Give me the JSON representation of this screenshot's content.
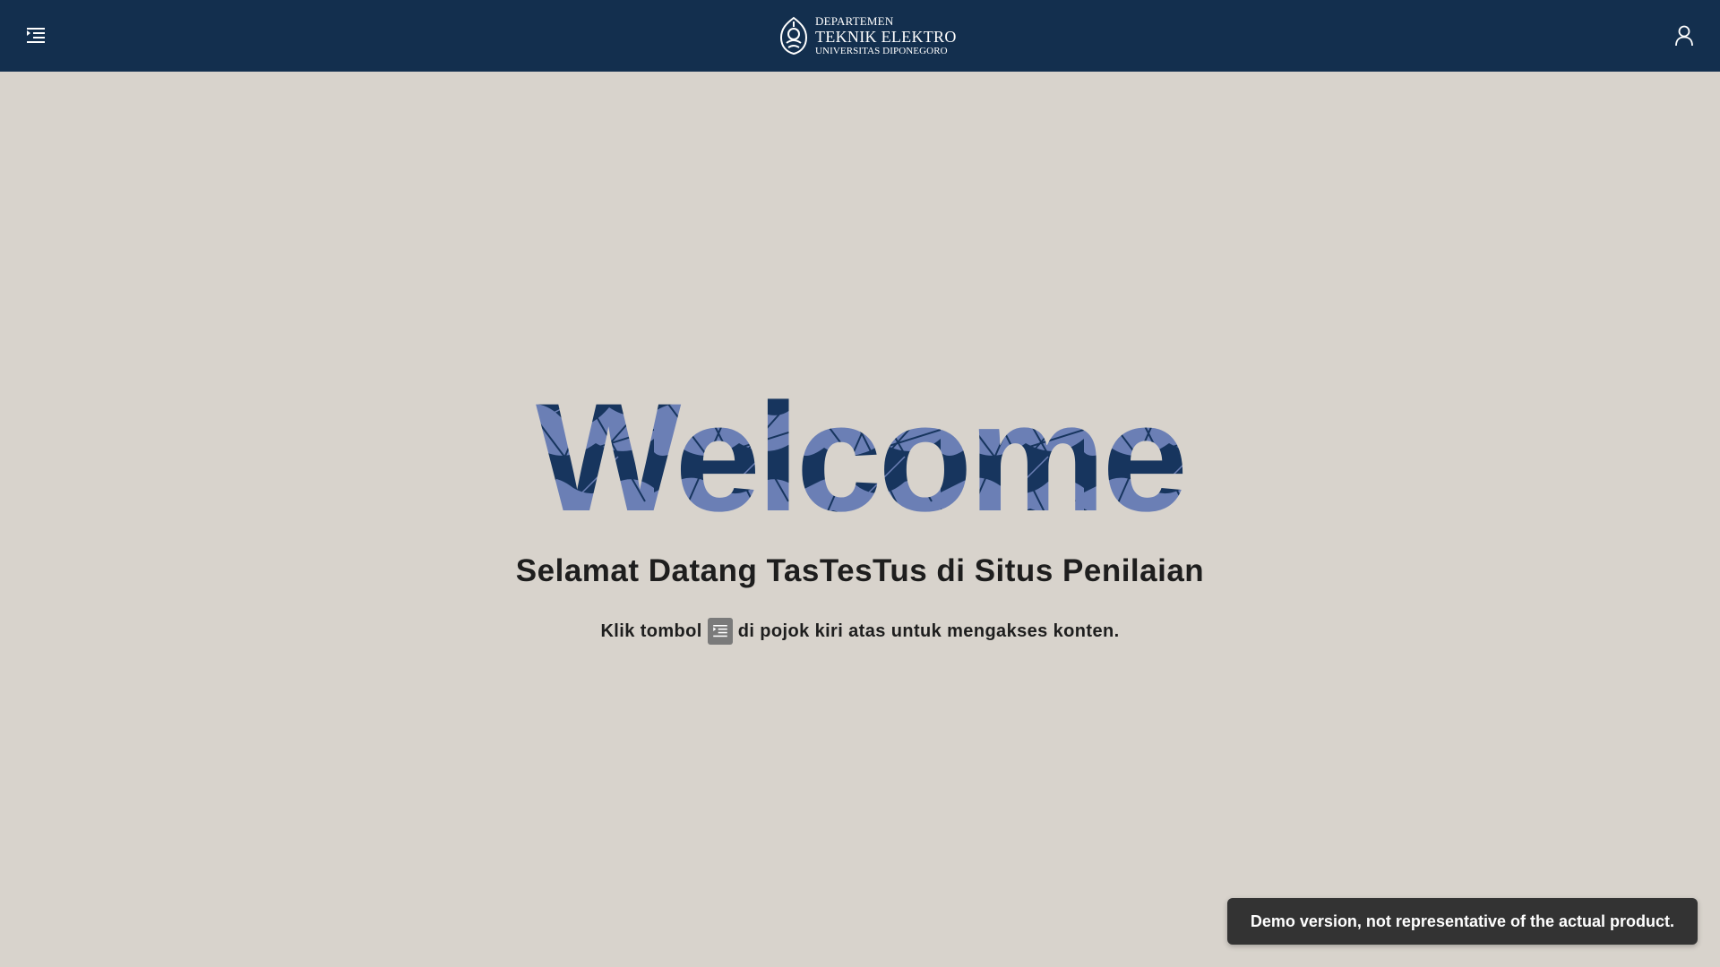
{
  "header": {
    "logo": {
      "line1": "DEPARTEMEN",
      "line2": "TEKNIK ELEKTRO",
      "line3": "UNIVERSITAS DIPONEGORO"
    },
    "menu_icon": "indent-list-icon",
    "user_icon": "user-icon"
  },
  "main": {
    "welcome_text": "Welcome",
    "headline": "Selamat Datang TasTesTus di Situs Penilaian",
    "instruction_before": "Klik tombol",
    "instruction_after": "di pojok kiri atas untuk mengakses konten."
  },
  "toast": {
    "message": "Demo version, not representative of the actual product."
  },
  "colors": {
    "header_bg": "#132f4e",
    "page_bg": "#d8d3cc",
    "welcome_dark": "#17355e",
    "welcome_light": "#6b7fb5",
    "toast_bg": "#333333"
  }
}
